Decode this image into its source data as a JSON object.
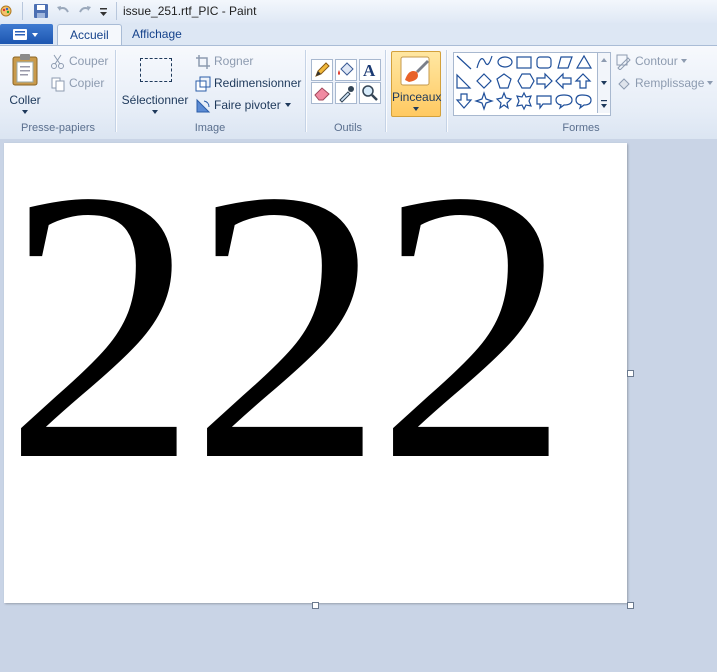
{
  "window": {
    "title": "issue_251.rtf_PIC - Paint"
  },
  "tabs": [
    {
      "label": "Accueil"
    },
    {
      "label": "Affichage"
    }
  ],
  "ribbon": {
    "clipboard": {
      "paste_label": "Coller",
      "cut_label": "Couper",
      "copy_label": "Copier",
      "group_label": "Presse-papiers"
    },
    "image": {
      "select_label": "Sélectionner",
      "crop_label": "Rogner",
      "resize_label": "Redimensionner",
      "rotate_label": "Faire pivoter",
      "group_label": "Image"
    },
    "tools": {
      "group_label": "Outils",
      "items": [
        "pencil-icon",
        "fill-icon",
        "text-icon",
        "eraser-icon",
        "color-picker-icon",
        "magnifier-icon"
      ]
    },
    "brushes": {
      "label": "Pinceaux"
    },
    "shapes": {
      "group_label": "Formes",
      "outline_label": "Contour",
      "fill_label": "Remplissage"
    }
  },
  "canvas": {
    "text": "222"
  }
}
